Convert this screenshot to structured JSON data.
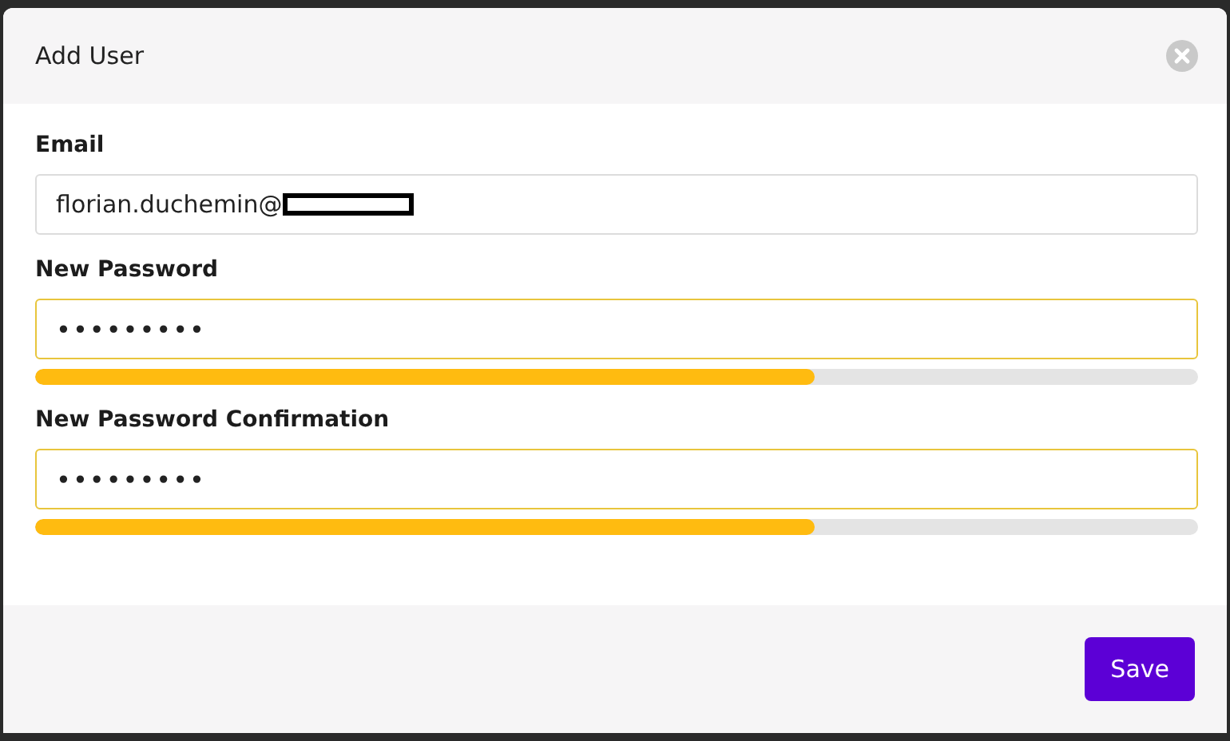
{
  "dialog": {
    "title": "Add User"
  },
  "fields": [
    {
      "kind": "text",
      "label": "Email",
      "value": "florian.duchemin@",
      "redacted": true
    },
    {
      "kind": "password",
      "label": "New Password",
      "value": "•••••••••",
      "level": 0.67
    },
    {
      "kind": "password",
      "label": "New Password Confirmation",
      "value": "•••••••••",
      "level": 0.67
    }
  ],
  "buttons": [
    {
      "label": "Save"
    }
  ]
}
